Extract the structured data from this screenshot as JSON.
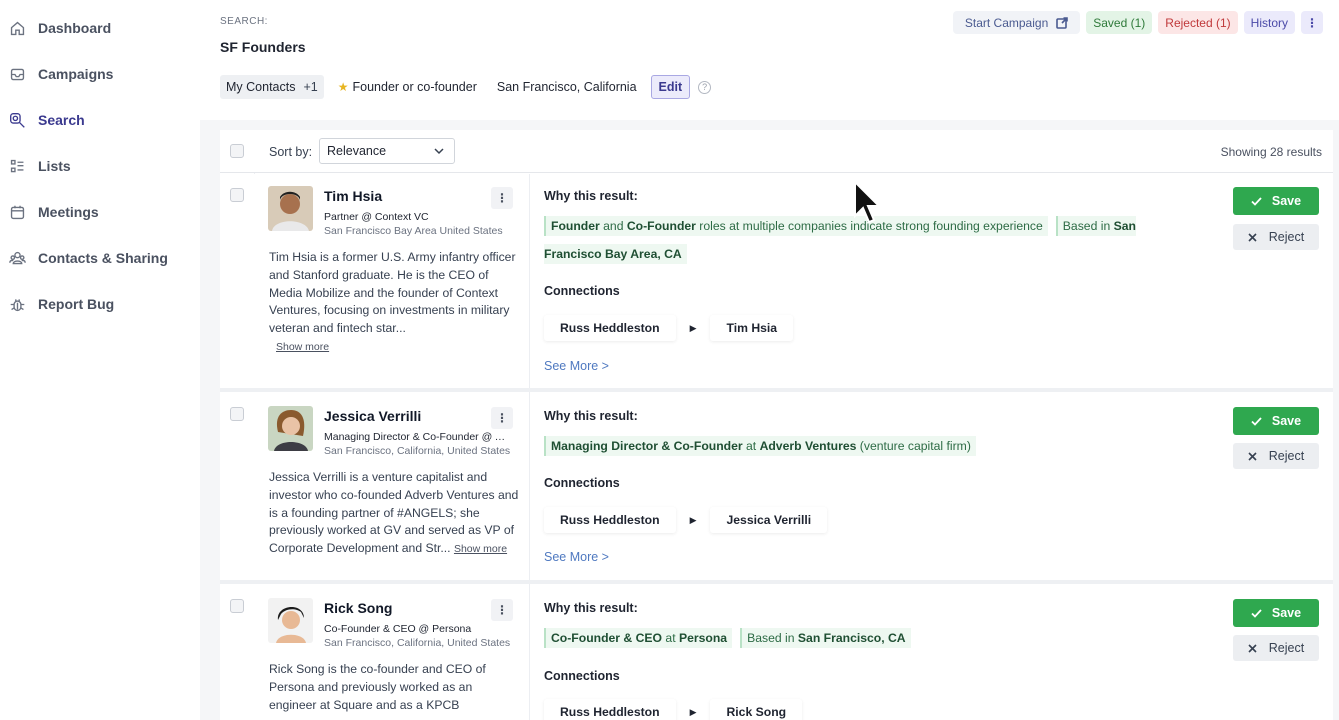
{
  "sidebar": {
    "items": [
      {
        "label": "Dashboard",
        "icon": "home-icon"
      },
      {
        "label": "Campaigns",
        "icon": "inbox-icon"
      },
      {
        "label": "Search",
        "icon": "search-icon",
        "active": true
      },
      {
        "label": "Lists",
        "icon": "list-icon"
      },
      {
        "label": "Meetings",
        "icon": "calendar-icon"
      },
      {
        "label": "Contacts & Sharing",
        "icon": "users-icon"
      },
      {
        "label": "Report Bug",
        "icon": "bug-icon"
      }
    ]
  },
  "header": {
    "search_label": "SEARCH:",
    "title": "SF Founders",
    "start_campaign": "Start Campaign",
    "saved": "Saved (1)",
    "rejected": "Rejected (1)",
    "history": "History",
    "more": "⋮"
  },
  "filters": {
    "contacts": "My Contacts",
    "contacts_extra": "+1",
    "role": "Founder or co-founder",
    "location": "San Francisco, California",
    "edit": "Edit",
    "help": "?"
  },
  "results": {
    "sort_label": "Sort by:",
    "sort_value": "Relevance",
    "showing": "Showing 28 results",
    "why_label": "Why this result:",
    "connections_label": "Connections",
    "see_more": "See More >",
    "save_label": "Save",
    "reject_label": "Reject",
    "show_more": "Show more",
    "items": [
      {
        "name": "Tim Hsia",
        "title": "Partner @ Context VC",
        "location": "San Francisco Bay Area United States",
        "bio": "Tim Hsia is a former U.S. Army infantry officer and Stanford graduate. He is the CEO of Media Mobilize and the founder of Context Ventures, focusing on investments in military veteran and fintech star...",
        "reason1_a": "Founder",
        "reason1_b": " and ",
        "reason1_c": "Co-Founder",
        "reason1_d": " roles at multiple companies indicate strong founding experience",
        "reason2_a": "Based in ",
        "reason2_b": "San Francisco Bay Area, CA",
        "conn_from": "Russ Heddleston",
        "conn_to": "Tim Hsia"
      },
      {
        "name": "Jessica Verrilli",
        "title": "Managing Director & Co-Founder @ Adverb Ventures",
        "location": "San Francisco, California, United States",
        "bio": "Jessica Verrilli is a venture capitalist and investor who co-founded Adverb Ventures and is a founding partner of #ANGELS; she previously worked at GV and served as VP of Corporate Development and Str...",
        "reason1_a": "Managing Director & Co-Founder",
        "reason1_b": " at ",
        "reason1_c": "Adverb Ventures",
        "reason1_d": " (venture capital firm)",
        "conn_from": "Russ Heddleston",
        "conn_to": "Jessica Verrilli"
      },
      {
        "name": "Rick Song",
        "title": "Co-Founder & CEO @ Persona",
        "location": "San Francisco, California, United States",
        "bio": "Rick Song is the co-founder and CEO of Persona and previously worked as an engineer at Square and as a KPCB",
        "reason1_a": "Co-Founder & CEO",
        "reason1_b": " at ",
        "reason1_c": "Persona",
        "reason2_a": "Based in ",
        "reason2_b": "San Francisco, CA",
        "conn_from": "Russ Heddleston",
        "conn_to": "Rick Song"
      }
    ]
  }
}
